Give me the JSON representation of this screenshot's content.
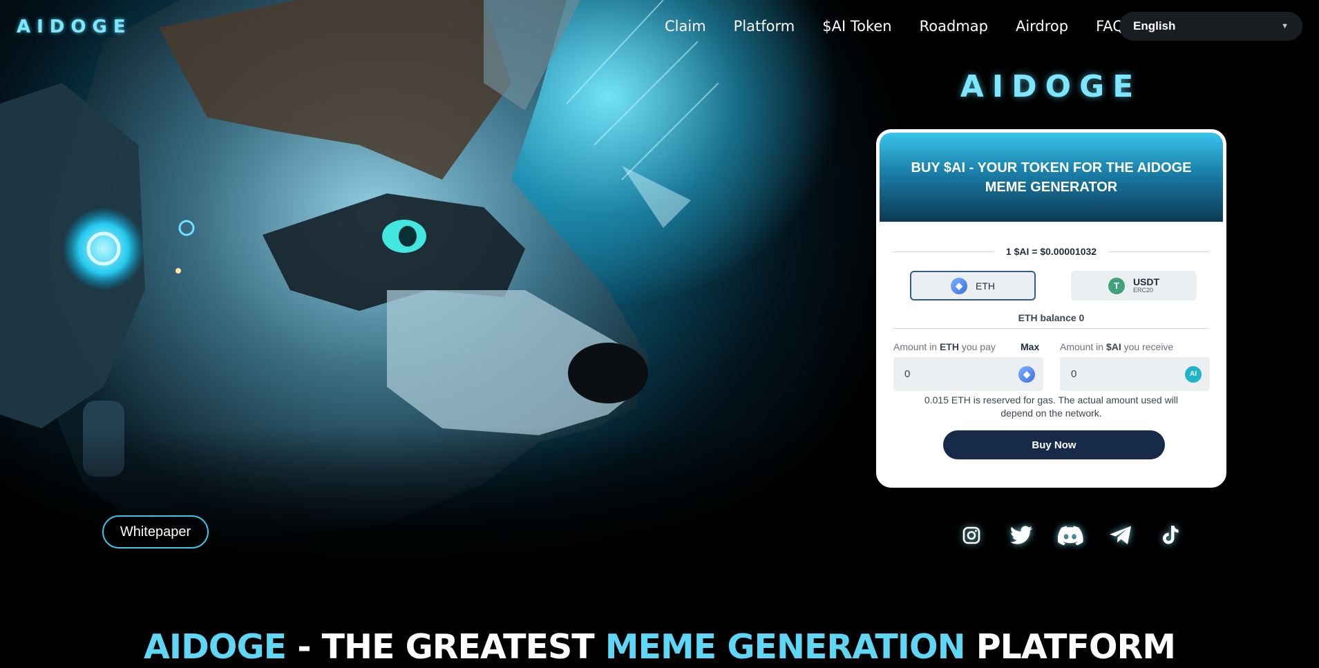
{
  "brand": {
    "logo_text": "AIDOGE",
    "accent": "#5fd6f4"
  },
  "nav": {
    "items": [
      "Claim",
      "Platform",
      "$AI Token",
      "Roadmap",
      "Airdrop",
      "FAQ"
    ]
  },
  "language": {
    "selected": "English"
  },
  "widget": {
    "title": "BUY $AI - YOUR TOKEN FOR THE AIDOGE MEME GENERATOR",
    "price": "1 $AI = $0.00001032",
    "pay_options": [
      {
        "label": "ETH",
        "icon": "ethereum-icon"
      },
      {
        "label": "USDT",
        "sublabel": "ERC20",
        "icon": "tether-icon"
      }
    ],
    "balance": "ETH balance 0",
    "pay_label_prefix": "Amount in ",
    "pay_label_token": "ETH",
    "pay_label_suffix": " you pay",
    "max_label": "Max",
    "receive_label_prefix": "Amount in ",
    "receive_label_token": "$AI",
    "receive_label_suffix": " you receive",
    "pay_value": "0",
    "receive_value": "0",
    "gas_note": "0.015 ETH is reserved for gas. The actual amount used will depend on the network.",
    "buy_label": "Buy Now"
  },
  "whitepaper_label": "Whitepaper",
  "socials": [
    "instagram-icon",
    "twitter-icon",
    "discord-icon",
    "telegram-icon",
    "tiktok-icon"
  ],
  "headline": {
    "part1": "AIDOGE",
    "part2": " - THE GREATEST ",
    "part3": "MEME GENERATION",
    "part4": " PLATFORM"
  }
}
